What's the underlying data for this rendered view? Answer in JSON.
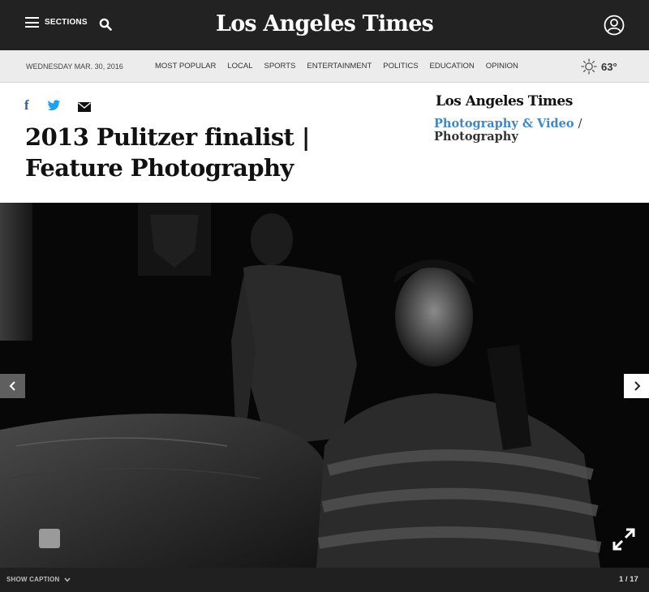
{
  "header": {
    "sections_label": "SECTIONS",
    "masthead": "Los Angeles Times"
  },
  "nav": {
    "date": "WEDNESDAY MAR. 30, 2016",
    "links": [
      "MOST POPULAR",
      "LOCAL",
      "SPORTS",
      "ENTERTAINMENT",
      "POLITICS",
      "EDUCATION",
      "OPINION"
    ],
    "temperature": "63°"
  },
  "article": {
    "share_facebook": "f",
    "headline": "2013 Pulitzer finalist | Feature Photography"
  },
  "sidebar": {
    "brand": "Los Angeles Times",
    "crumb_section": "Photography & Video",
    "crumb_separator": "/",
    "crumb_current": "Photography"
  },
  "gallery": {
    "show_caption": "SHOW CAPTION",
    "counter": "1 / 17"
  },
  "icons": {
    "menu": "hamburger-icon",
    "search": "search-icon",
    "user": "user-icon",
    "weather": "sun-icon",
    "facebook": "facebook-icon",
    "twitter": "twitter-icon",
    "email": "email-icon",
    "prev": "chevron-left-icon",
    "next": "chevron-right-icon",
    "expand": "expand-icon",
    "caption_toggle": "chevron-down-icon"
  },
  "colors": {
    "header_bg": "#222222",
    "nav_bg": "#ececec",
    "link_blue": "#4387bd",
    "facebook_blue": "#3b5998",
    "twitter_blue": "#1da1f2"
  }
}
